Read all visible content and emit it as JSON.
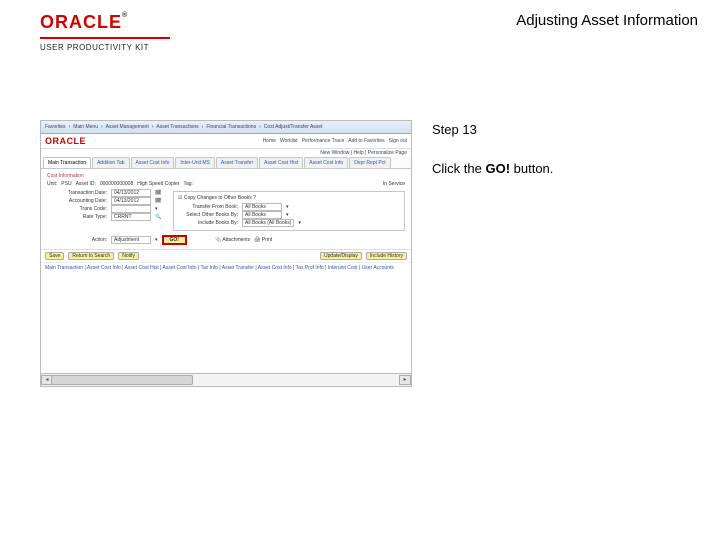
{
  "header": {
    "brand": "ORACLE",
    "tm": "®",
    "product_line": "USER PRODUCTIVITY KIT",
    "page_title": "Adjusting Asset Information"
  },
  "step": {
    "label": "Step 13",
    "text_pre": "Click the ",
    "action": "GO!",
    "text_post": " button."
  },
  "screenshot": {
    "menubar": [
      "Favorites",
      "Main Menu",
      "Asset Management",
      "Asset Transactions",
      "Financial Transactions",
      "Cost Adjust/Transfer Asset"
    ],
    "brand": "ORACLE",
    "hdr_links": [
      "Home",
      "Worklist",
      "Performance Trace",
      "Add to Favorites",
      "Sign out"
    ],
    "breadcrumb": "New Window | Help | Personalize Page",
    "tabs": [
      "Main Transaction",
      "Addition Tab",
      "Asset Cost Info",
      "Inter-Unit MS",
      "Asset Transfer",
      "Asset Cost Hist",
      "Asset Cost Info",
      "Depr Rept Pct"
    ],
    "active_tab_index": 0,
    "highlight_label": "Cost Information",
    "unit_row": {
      "unit_label": "Unit:",
      "unit_val": "PSU",
      "asset_label": "Asset ID:",
      "asset_val": "000000000008",
      "asset_name": "High Speed Copier",
      "tag_label": "Tag:",
      "status_label": "In Service"
    },
    "form": {
      "trans_date_label": "Transaction Date:",
      "trans_date": "04/13/2012",
      "acct_date_label": "Accounting Date:",
      "acct_date": "04/13/2012",
      "trans_code_label": "Trans Code:",
      "rate_type_label": "Rate Type:",
      "rate_type": "CRRNT"
    },
    "copy_panel": {
      "title": "Copy Changes to Other Books ?",
      "rows": [
        {
          "label": "Transfer From Book:",
          "value": "All Books"
        },
        {
          "label": "Select Other Books By:",
          "value": "All Books"
        },
        {
          "label": "Include Books By:",
          "value": "All Books (All Books)"
        }
      ]
    },
    "action_label": "Action:",
    "action_value": "Adjustment",
    "go_label": "GO!",
    "attach_label": "Attachments",
    "print_label": "Print",
    "footer_btns": [
      "Save",
      "Return to Search",
      "Notify"
    ],
    "footer_right": [
      "Update/Display",
      "Include History"
    ],
    "bottom_links": "Main Transaction | Asset Cost Info | Asset Cost Hist | Asset Cost Info | Tax Info | Asset Transfer | Asset Cost Info | Tax Prof Info | Interunit Cost | User Accounts"
  }
}
